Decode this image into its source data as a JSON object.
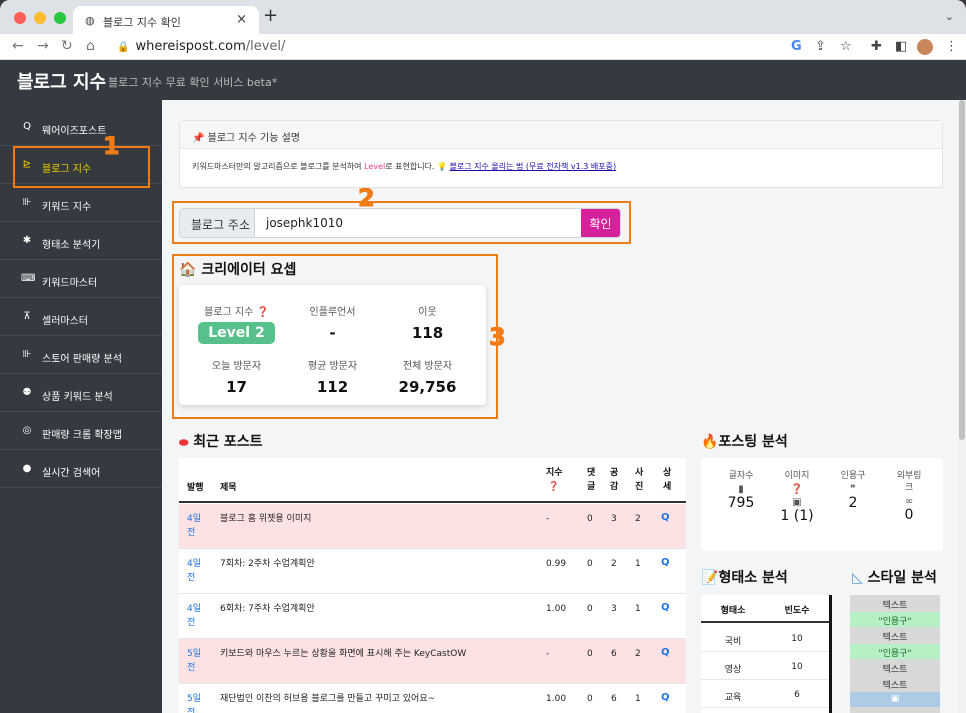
{
  "browser": {
    "tab_title": "블로그 지수 확인",
    "url_host": "whereispost.com",
    "url_path": "/level/",
    "new_tab": "+",
    "close": "×"
  },
  "site": {
    "brand": "블로그 지수",
    "subtitle": "블로그 지수 무료 확인 서비스 beta*"
  },
  "sidebar": {
    "items": [
      {
        "icon": "search-icon",
        "glyph": "Q",
        "label": "웨어이즈포스트"
      },
      {
        "icon": "chart-line-icon",
        "glyph": "⊵",
        "label": "블로그 지수"
      },
      {
        "icon": "bar-chart-icon",
        "glyph": "⊪",
        "label": "키워드 지수"
      },
      {
        "icon": "gear-icon",
        "glyph": "✱",
        "label": "형태소 분석기"
      },
      {
        "icon": "keyboard-icon",
        "glyph": "⌨",
        "label": "키워드마스터"
      },
      {
        "icon": "cart-icon",
        "glyph": "⊼",
        "label": "셀러마스터"
      },
      {
        "icon": "bar-chart-icon",
        "glyph": "⊪",
        "label": "스토어 판매량 분석"
      },
      {
        "icon": "users-icon",
        "glyph": "⚉",
        "label": "상품 키워드 분석"
      },
      {
        "icon": "chrome-icon",
        "glyph": "◎",
        "label": "판매량 크롬 확장앱"
      },
      {
        "icon": "clock-icon",
        "glyph": "●",
        "label": "실시간 검색어"
      }
    ]
  },
  "annotations": [
    "1",
    "2",
    "3"
  ],
  "info": {
    "header": "블로그 지수 기능 설명",
    "body_prefix": "키워드마스터만의 알고리즘으로 블로그를 분석하여 ",
    "body_level": "Level",
    "body_suffix": "로 표현합니다. 💡 ",
    "body_link": "블로그 지수 올리는 법 (무료 전자책 v1.3 배포중)"
  },
  "search": {
    "label": "블로그 주소",
    "value": "josephk1010",
    "button": "확인"
  },
  "creator": {
    "title": "크리에이터 요셉",
    "stats": [
      {
        "label": "블로그 지수 ❓",
        "value": "Level 2",
        "badge": true
      },
      {
        "label": "인플루언서",
        "value": "-"
      },
      {
        "label": "이웃",
        "value": "118"
      },
      {
        "label": "오늘 방문자",
        "value": "17"
      },
      {
        "label": "평균 방문자",
        "value": "112"
      },
      {
        "label": "전체 방문자",
        "value": "29,756"
      }
    ]
  },
  "recent": {
    "title": "최근 포스트",
    "headers": {
      "date": "발행",
      "title": "제목",
      "index": "지수",
      "index_icon": "❓",
      "comments": "댓\n글",
      "likes": "공\n감",
      "photos": "사\n진",
      "detail": "상\n세"
    },
    "rows": [
      {
        "date": "4일\n전",
        "title": "블로그 홈 위젯용 이미지",
        "index": "-",
        "comments": "0",
        "likes": "3",
        "photos": "2",
        "pink": true
      },
      {
        "date": "4일\n전",
        "title": "7회차: 2주차 수업계획안",
        "index": "0.99",
        "comments": "0",
        "likes": "2",
        "photos": "1",
        "pink": false
      },
      {
        "date": "4일\n전",
        "title": "6회차: 7주차 수업계획안",
        "index": "1.00",
        "comments": "0",
        "likes": "3",
        "photos": "1",
        "pink": false
      },
      {
        "date": "5일\n전",
        "title": "키보드와 마우스 누르는 상황을 화면에 표시해 주는 KeyCastOW",
        "index": "-",
        "comments": "0",
        "likes": "6",
        "photos": "2",
        "pink": true
      },
      {
        "date": "5일\n전",
        "title": "재단법인 이찬의 허브용 블로그를 만들고 꾸미고 있어요~",
        "index": "1.00",
        "comments": "0",
        "likes": "6",
        "photos": "1",
        "pink": false
      }
    ]
  },
  "posting": {
    "title": "포스팅 분석",
    "stats": [
      {
        "label": "글자수",
        "icon": "file-icon",
        "glyph": "▮",
        "value": "795"
      },
      {
        "label": "이미지",
        "icon": "question-icon",
        "glyph": "❓",
        "value": "1 (1)",
        "extra_glyph": "▣"
      },
      {
        "label": "인용구",
        "icon": "quote-icon",
        "glyph": "❞",
        "value": "2"
      },
      {
        "label": "외부링\n크",
        "icon": "link-icon",
        "glyph": "∞",
        "value": "0"
      }
    ]
  },
  "morph": {
    "title": "형태소 분석",
    "headers": [
      "형태소",
      "빈도수"
    ],
    "rows": [
      {
        "word": "국비",
        "count": "10"
      },
      {
        "word": "영상",
        "count": "10"
      },
      {
        "word": "교육",
        "count": "6"
      }
    ]
  },
  "style": {
    "title": "스타일 분석",
    "lines": [
      {
        "text": "텍스트",
        "kind": "text"
      },
      {
        "text": "\"인용구\"",
        "kind": "quote"
      },
      {
        "text": "텍스트",
        "kind": "text"
      },
      {
        "text": "\"인용구\"",
        "kind": "quote"
      },
      {
        "text": "텍스트",
        "kind": "text"
      },
      {
        "text": "텍스트",
        "kind": "text"
      },
      {
        "text": "▣",
        "kind": "img"
      }
    ]
  },
  "colors": {
    "accent": "#d6219c",
    "annotation": "#f07c18",
    "sidebar": "#343a40",
    "active": "#f5d000",
    "level": "#58c08a"
  }
}
